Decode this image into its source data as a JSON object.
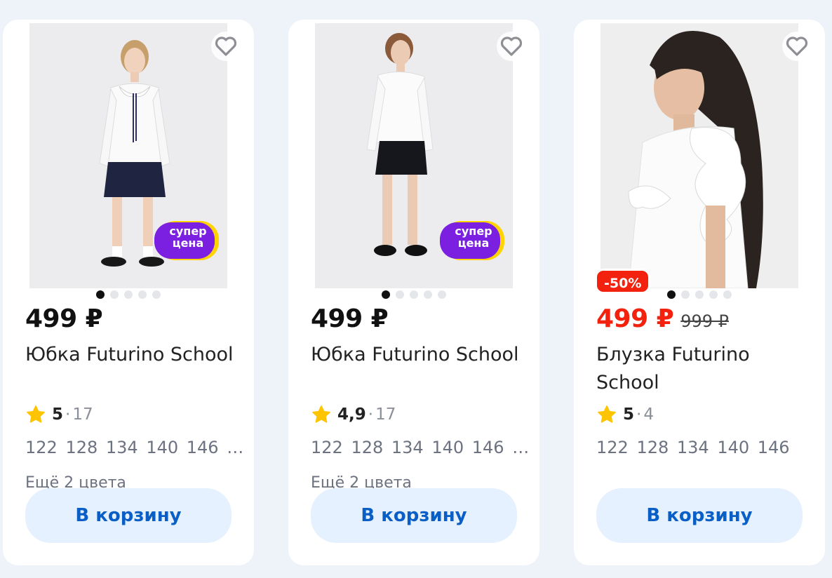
{
  "colors": {
    "page_bg": "#eef3fa",
    "sale_red": "#f2220f",
    "button_bg": "#e5f1fe",
    "button_text": "#0a5fc6",
    "promo_purple": "#7b1fe0",
    "promo_yellow": "#ffd400",
    "star": "#ffc400"
  },
  "products": [
    {
      "price": "499 ₽",
      "old_price": "",
      "discount_badge": "",
      "title": "Юбка Futurino School",
      "rating_value": "5",
      "rating_sep": "·",
      "rating_count": "17",
      "sizes": "122 128 134 140 146 …",
      "more_colors": "Ещё 2 цвета",
      "cart_label": "В корзину",
      "promo_label": "супер цена",
      "promo_line1": "супер",
      "promo_line2": "цена",
      "photo_dots": 5,
      "active_dot": 0
    },
    {
      "price": "499 ₽",
      "old_price": "",
      "discount_badge": "",
      "title": "Юбка Futurino School",
      "rating_value": "4,9",
      "rating_sep": "·",
      "rating_count": "17",
      "sizes": "122 128 134 140 146 …",
      "more_colors": "Ещё 2 цвета",
      "cart_label": "В корзину",
      "promo_label": "супер цена",
      "promo_line1": "супер",
      "promo_line2": "цена",
      "photo_dots": 5,
      "active_dot": 0
    },
    {
      "price": "499 ₽",
      "old_price": "999 ₽",
      "discount_badge": "-50%",
      "title": "Блузка Futurino School",
      "rating_value": "5",
      "rating_sep": "·",
      "rating_count": "4",
      "sizes": "122 128 134 140 146",
      "more_colors": "",
      "cart_label": "В корзину",
      "promo_label": "",
      "photo_dots": 5,
      "active_dot": 0
    }
  ]
}
